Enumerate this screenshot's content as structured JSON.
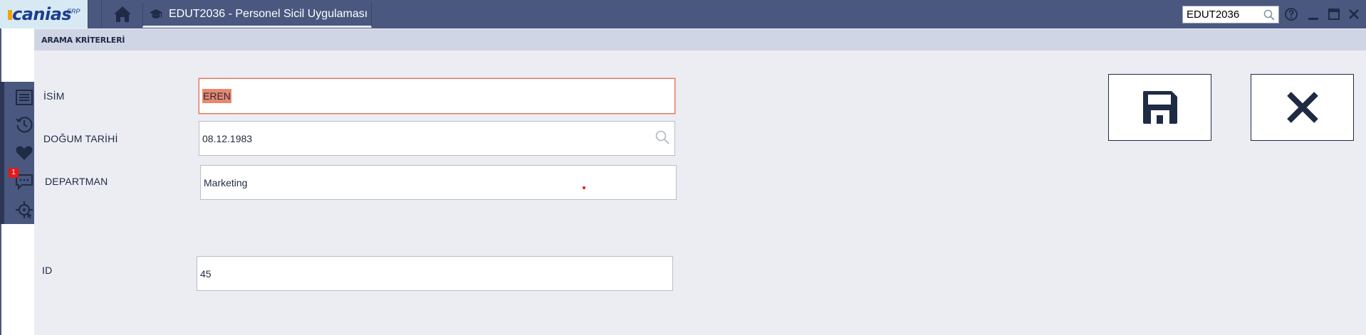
{
  "topbar": {
    "logo_text": "canias",
    "logo_sup": "ERP",
    "tab_label": "EDUT2036 - Personel Sicil Uygulaması",
    "search_value": "EDUT2036",
    "icons": [
      "home-icon",
      "graduation-cap-icon",
      "search-icon",
      "help-icon",
      "minimize-icon",
      "maximize-icon",
      "close-window-icon"
    ],
    "background": "#4a5880"
  },
  "section": {
    "title": "ARAMA KRİTERLERİ"
  },
  "sidebar": {
    "icons": [
      "list-icon",
      "history-icon",
      "favorites-heart-icon",
      "messages-icon",
      "target-icon"
    ],
    "message_badge": "1"
  },
  "form": {
    "name_label": "İSİM",
    "name_value": "EREN",
    "birth_label": "DOĞUM TARİHİ",
    "birth_value": "08.12.1983",
    "dept_label": "DEPARTMAN",
    "dept_value": "Marketing",
    "id_label": "ID",
    "id_value": "45"
  },
  "actions": {
    "save_icon": "save-floppy-icon",
    "cancel_icon": "close-x-icon"
  },
  "colors": {
    "accent": "#4a5880",
    "selection": "#e8886c",
    "focus_border": "#e0735e",
    "badge": "#e31a1a"
  }
}
